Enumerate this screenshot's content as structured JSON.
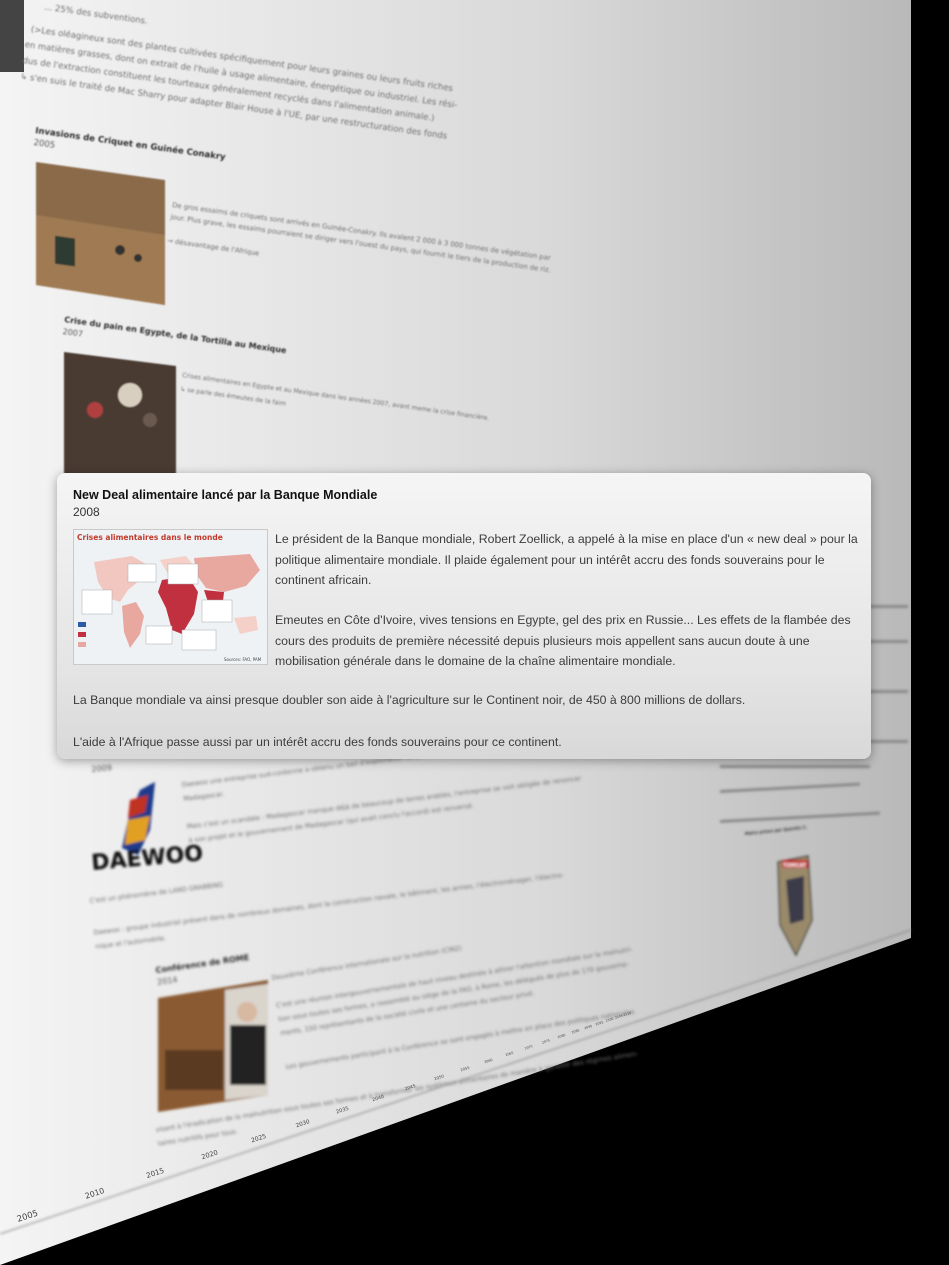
{
  "card": {
    "title": "New Deal alimentaire lancé par la Banque Mondiale",
    "year": "2008",
    "map": {
      "title": "Crises alimentaires dans le monde",
      "source": "Sources: FAO, PAM"
    },
    "paragraphs": [
      "Le président de la Banque mondiale, Robert Zoellick, a appelé à la mise en place d'un « new deal » pour la politique alimentaire mondiale. Il plaide également pour un intérêt accru des fonds souverains pour le continent africain.",
      "Emeutes en Côte d'Ivoire, vives tensions en Egypte, gel des prix en Russie... Les effets de la flambée des cours des produits de première nécessité depuis plusieurs mois appellent sans aucun doute à une mobilisation générale dans le domaine de la chaîne alimentaire mondiale.",
      "La Banque mondiale va ainsi presque doubler son aide à l'agriculture sur le Continent noir, de 450 à 800 millions de dollars.",
      "L'aide à l'Afrique passe aussi par un intérêt accru des fonds souverains pour ce continent."
    ]
  },
  "background": {
    "top_lines": [
      "... 25% des subventions.",
      "(>Les oléagineux sont des plantes cultivées spécifiquement pour leurs graines ou leurs fruits riches",
      "en matières grasses, dont on extrait de l'huile à usage alimentaire, énergétique ou industriel. Les rési-",
      "dus de l'extraction constituent les tourteaux généralement recyclés dans l'alimentation animale.)",
      "↳ s'en suis le traité de Mac Sharry pour adapter Blair House à l'UE, par une restructuration des fonds"
    ],
    "events": [
      {
        "title": "Invasions de Criquet en Guinée Conakry",
        "year": "2005",
        "lines": [
          "De gros essaims de criquets sont arrivés en Guinée-Conakry. Ils avalent 2 000 à 3 000 tonnes de végétation par",
          "jour. Plus grave, les essaims pourraient se diriger vers l'ouest du pays, qui fournit le tiers de la production de riz.",
          "→ désavantage de l'Afrique"
        ]
      },
      {
        "title": "Crise du pain en Egypte, de la Tortilla au Mexique",
        "year": "2007",
        "lines": [
          "Crises alimentaires en Egypte et au Mexique dans les années 2007, avant meme la crise financière.",
          "↳ se parle des émeutes de la faim"
        ]
      },
      {
        "title": "Daewoo",
        "year": "2009",
        "lines": [
          "Daewoo une entreprise sud-coréenne a obtenu un bail d'exploitation de plus d'1M d'hectares de surfaces agricoles à",
          "Madagascar.",
          "Mais c'est un scandale : Madagascar manque déjà de beaucoup de terres arables, l'entreprise se voit obligée de renoncer",
          "à son projet et le gouvernement de Madagascar (qui avait conclu l'accord) est renversé.",
          "C'est un phénomène de LAND GRABBING",
          "Daewoo : groupe industriel présent dans de nombreux domaines, dont la construction navale, le bâtiment, les armes, l'électroménager, l'électro-",
          "nique et l'automobile."
        ],
        "logo": "DAEWOO"
      },
      {
        "title": "Conférence de ROME",
        "year": "2014",
        "lines": [
          "Deuxième Conférence internationale sur la nutrition (CIN2)",
          "C'est une réunion intergouvernementale de haut niveau destinée à attirer l'attention mondiale sur la malnutri-",
          "tion sous toutes ses formes, a rassemblé au siège de la FAO, à Rome, les délégués de plus de 170 gouverne-",
          "ments, 150 représentants de la société civile et une centaine du secteur privé.",
          "Les gouvernements participant à la Conférence se sont engagés à mettre en place des politiques nationales",
          "visant à l'éradication de la malnutrition sous toutes ses formes et à transformer les systèmes alimentaires de manière à garantir des régimes alimen-",
          "taires nutritifs pour tous."
        ]
      }
    ],
    "axis_years": [
      "2005",
      "2010",
      "2015",
      "2020",
      "2025",
      "2030",
      "2035",
      "2040",
      "2045",
      "2050",
      "2055",
      "2060",
      "2065",
      "2070",
      "2075",
      "2080",
      "2085",
      "2090",
      "2095",
      "2100",
      "2105",
      "2110"
    ],
    "right_card_title": "Mains prises par Quentin C.",
    "badge_text": "TOMCAT"
  },
  "colors": {
    "card_bg": "#eeeeee",
    "map_red": "#c0303f",
    "map_title": "#c23a2b",
    "backdrop": "#000000"
  }
}
